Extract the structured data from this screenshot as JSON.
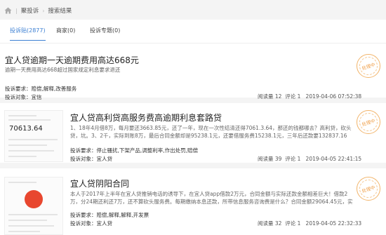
{
  "breadcrumb": {
    "home": "聚投诉",
    "current": "搜索结果"
  },
  "tabs": [
    {
      "label": "投诉贴(2877)"
    },
    {
      "label": "商家(0)"
    },
    {
      "label": "投诉专题(0)"
    }
  ],
  "results": [
    {
      "title": "宜人贷逾期一天逾期费用高达668元",
      "desc": "逾期一天费用高达668超过国家规定利息要求退还",
      "demand_label": "投诉要求：",
      "demand": "赔偿,解释,改善服务",
      "target_label": "投诉对象：",
      "target": "宜信",
      "reads_label": "阅读量",
      "reads": "12",
      "comments_label": "评论",
      "comments": "1",
      "date": "2019-04-06 07:52:38",
      "status": "处理中"
    },
    {
      "title": "宜人贷高利贷高服务费高逾期利息套路贷",
      "desc": "1、18年4月借8万，每月要还3663.85元，还了一年，现在一次性结清还得7061.3.64，那还的钱都哪去？高利贷，砍头贷，坑。3、2千，实际到账8万，最后合同金额却是95238.1元，还要借服务费15238.1元，三年后还款要132837.16元...",
      "demand_label": "投诉要求：",
      "demand": "停止骚扰,下架产品,调整利率,作出处罚,赔偿",
      "target_label": "投诉对象：",
      "target": "宜人贷",
      "reads_label": "阅读量",
      "reads": "39",
      "comments_label": "评论",
      "comments": "1",
      "date": "2019-04-05 22:41:15",
      "status": "处理中",
      "thumb_value": "70613.64"
    },
    {
      "title": "宜人贷阴阳合同",
      "desc": "本人于2017年上半年在宜人贷推销电话的诱导下，在宜人贷app借款2万元，合同金额与实际还款金额相差巨大！借款2万，分24期还利还7万，还不算砍头服务费。每期缴纳本息还款，所带信息服务咨询费是什么？合同金额29064.45元，实际到账2...",
      "demand_label": "投诉要求：",
      "demand": "赔偿,解释,解释,开发票",
      "target_label": "投诉对象：",
      "target": "宜人贷",
      "reads_label": "阅读量",
      "reads": "32",
      "comments_label": "评论",
      "comments": "1",
      "date": "2019-04-05 22:32:33",
      "status": "处理中"
    }
  ],
  "colors": {
    "accent": "#3b7fd3",
    "stamp": "#f0a24e"
  },
  "icons": {
    "home": "home-icon",
    "status": "status-stamp"
  }
}
